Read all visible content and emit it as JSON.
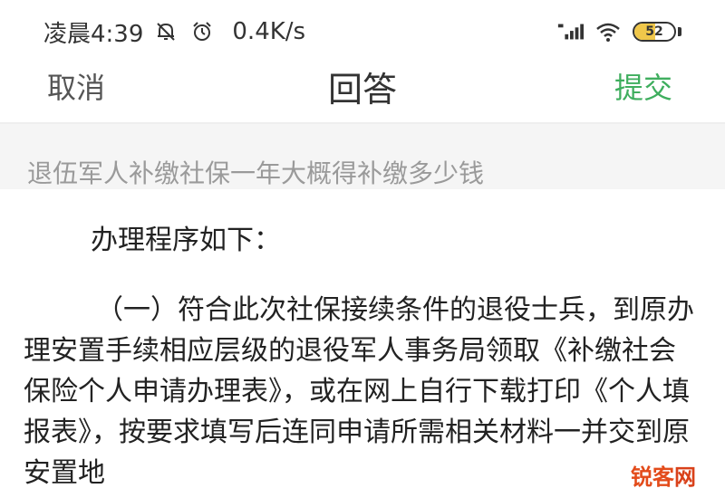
{
  "status_bar": {
    "time": "凌晨4:39",
    "network_speed": "0.4K/s",
    "battery_level": "52",
    "battery_fraction": 0.52,
    "icons": [
      "alarm-off-icon",
      "alarm-clock-icon",
      "signal-hd-icon",
      "wifi-icon",
      "battery-icon"
    ]
  },
  "nav": {
    "cancel_label": "取消",
    "title": "回答",
    "submit_label": "提交",
    "submit_color": "#3fae5e"
  },
  "question": {
    "text": "退伍军人补缴社保一年大概得补缴多少钱"
  },
  "answer": {
    "heading": "办理程序如下：",
    "paragraph": "（一）符合此次社保接续条件的退役士兵，到原办理安置手续相应层级的退役军人事务局领取《补缴社会保险个人申请办理表》，或在网上自行下载打印《个人填报表》，按要求填写后连同申请所需相关材料一并交到原安置地"
  },
  "watermark": {
    "main": "锐客",
    "suffix": "网"
  }
}
